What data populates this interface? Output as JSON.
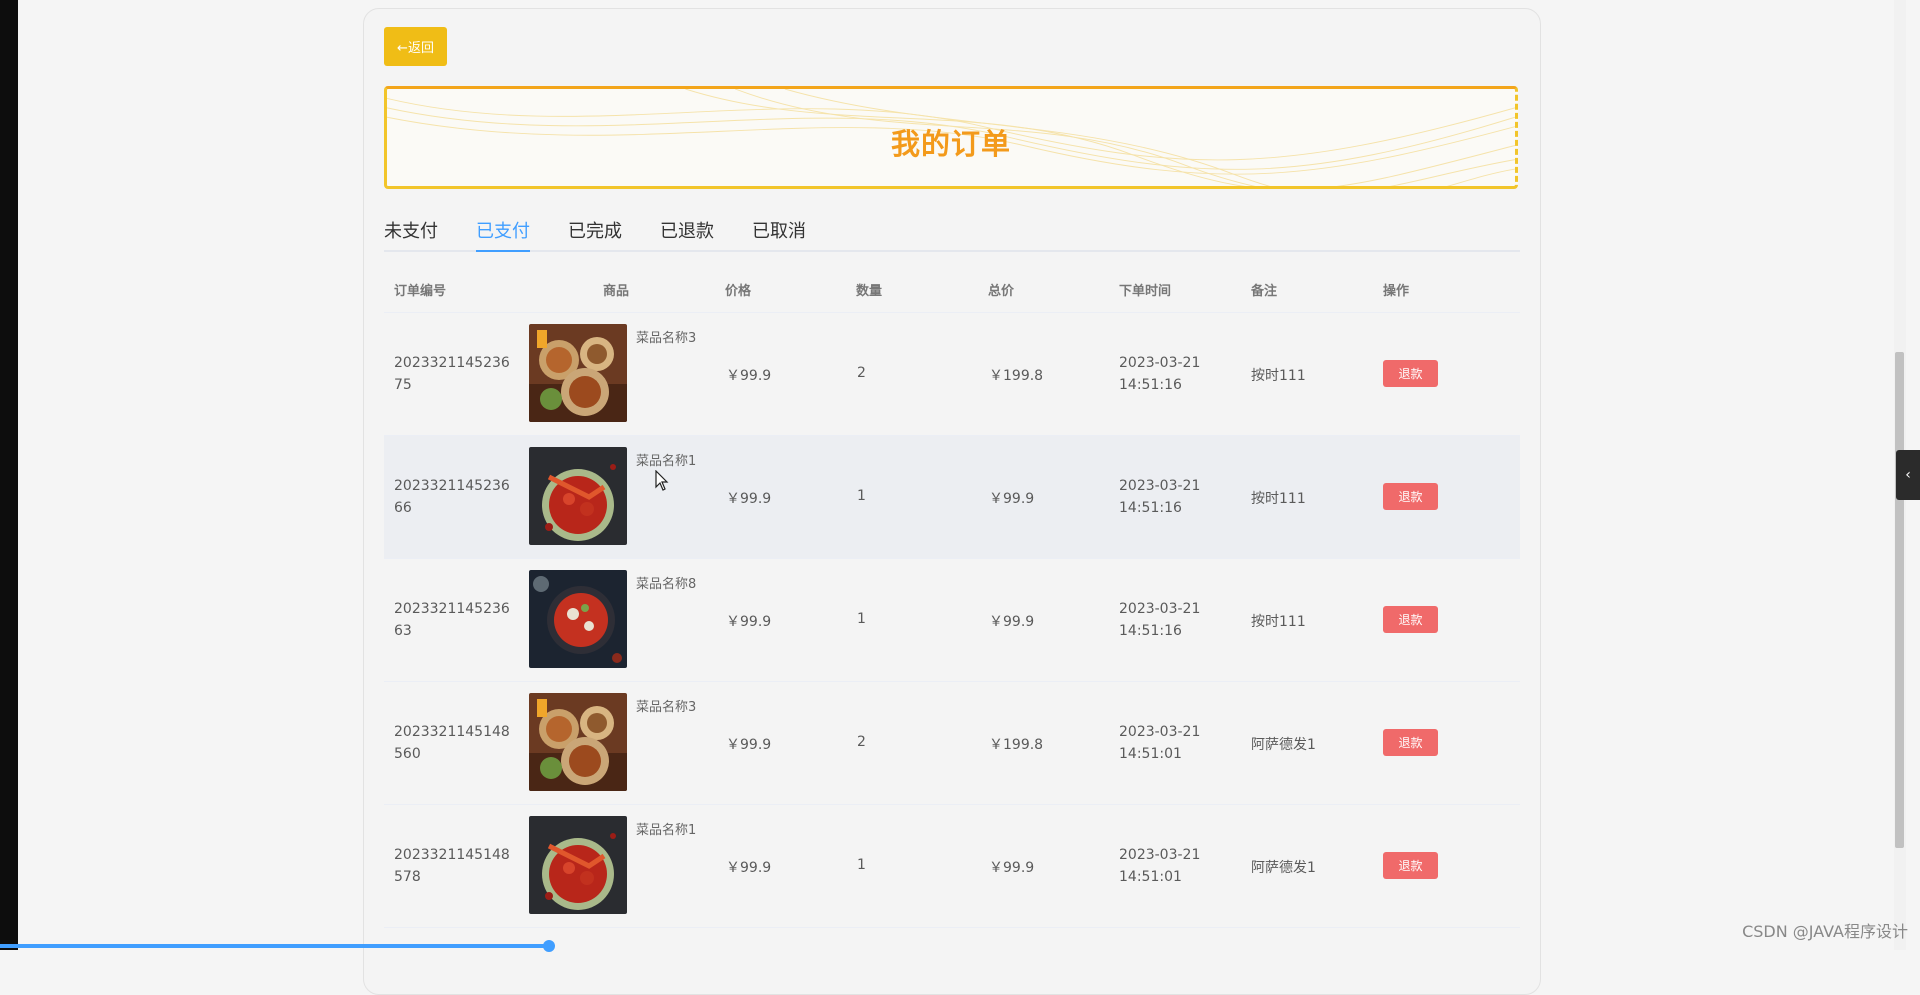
{
  "back_button": {
    "label": "←返回"
  },
  "banner": {
    "title": "我的订单"
  },
  "tabs": [
    {
      "label": "未支付",
      "active": false
    },
    {
      "label": "已支付",
      "active": true
    },
    {
      "label": "已完成",
      "active": false
    },
    {
      "label": "已退款",
      "active": false
    },
    {
      "label": "已取消",
      "active": false
    }
  ],
  "table": {
    "headers": [
      "订单编号",
      "商品",
      "价格",
      "数量",
      "总价",
      "下单时间",
      "备注",
      "操作"
    ],
    "rows": [
      {
        "order_id": "202332114523675",
        "dish_image": "food-platter-image",
        "dish_name": "菜品名称3",
        "price": "￥99.9",
        "quantity": "2",
        "total": "￥199.8",
        "time": "2023-03-21 14:51:16",
        "remark": "按时111",
        "action": "退款"
      },
      {
        "order_id": "202332114523666",
        "dish_image": "crayfish-dish-image",
        "dish_name": "菜品名称1",
        "price": "￥99.9",
        "quantity": "1",
        "total": "￥99.9",
        "time": "2023-03-21 14:51:16",
        "remark": "按时111",
        "action": "退款"
      },
      {
        "order_id": "202332114523663",
        "dish_image": "hotpot-dish-image",
        "dish_name": "菜品名称8",
        "price": "￥99.9",
        "quantity": "1",
        "total": "￥99.9",
        "time": "2023-03-21 14:51:16",
        "remark": "按时111",
        "action": "退款"
      },
      {
        "order_id": "2023321145148560",
        "dish_image": "food-platter-image",
        "dish_name": "菜品名称3",
        "price": "￥99.9",
        "quantity": "2",
        "total": "￥199.8",
        "time": "2023-03-21 14:51:01",
        "remark": "阿萨德发1",
        "action": "退款"
      },
      {
        "order_id": "2023321145148578",
        "dish_image": "crayfish-dish-image",
        "dish_name": "菜品名称1",
        "price": "￥99.9",
        "quantity": "1",
        "total": "￥99.9",
        "time": "2023-03-21 14:51:01",
        "remark": "阿萨德发1",
        "action": "退款"
      }
    ]
  },
  "watermark": "CSDN @JAVA程序设计",
  "colors": {
    "accent": "#409eff",
    "back_button": "#f0bd16",
    "banner_title": "#f39a1b",
    "refund_button": "#f06a6a"
  }
}
